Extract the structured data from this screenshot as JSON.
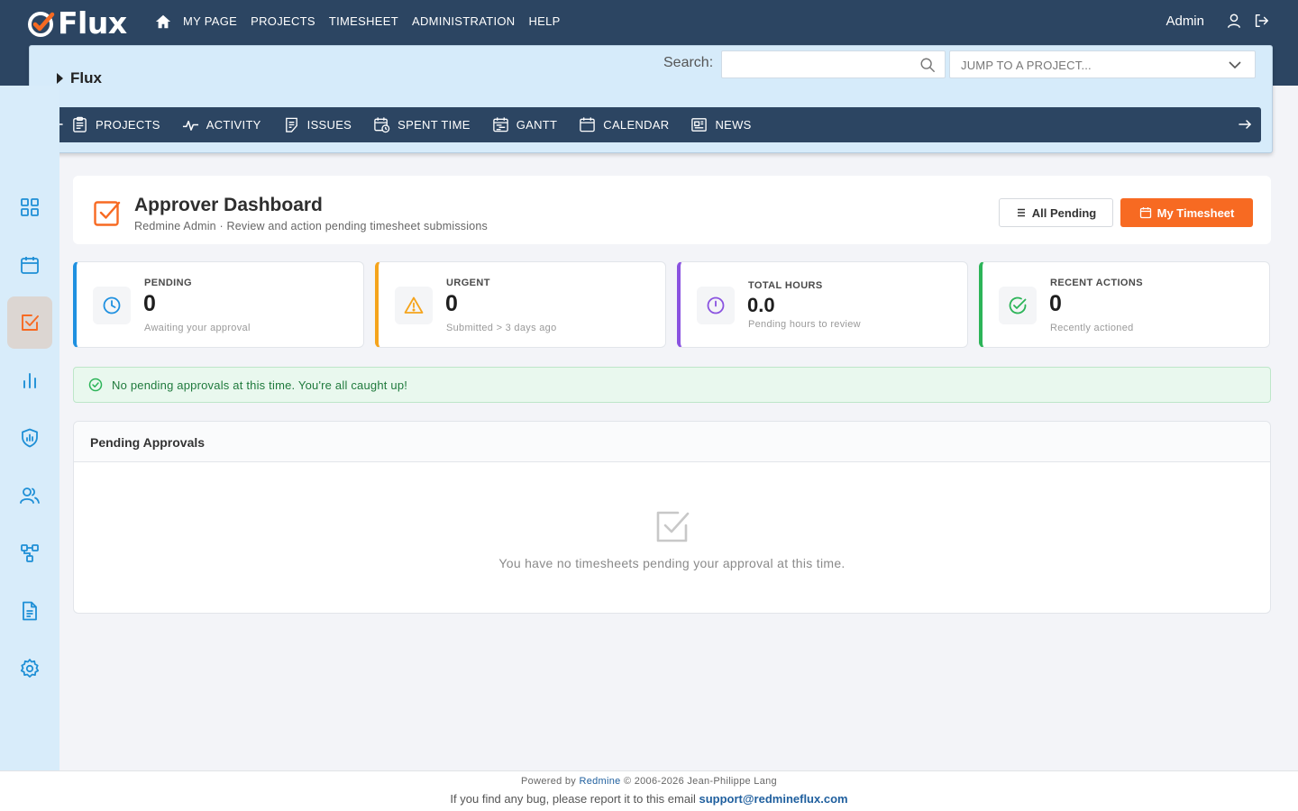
{
  "app": {
    "logo_text": "Flux"
  },
  "topnav": {
    "items": [
      "MY PAGE",
      "PROJECTS",
      "TIMESHEET",
      "ADMINISTRATION",
      "HELP"
    ],
    "user": "Admin"
  },
  "project": {
    "name": "Flux",
    "search_label": "Search:",
    "search_value": "",
    "jump_placeholder": "JUMP TO A PROJECT..."
  },
  "project_menu": {
    "items": [
      {
        "label": "PROJECTS",
        "icon": "clipboard-icon"
      },
      {
        "label": "ACTIVITY",
        "icon": "activity-icon"
      },
      {
        "label": "ISSUES",
        "icon": "issues-icon"
      },
      {
        "label": "SPENT TIME",
        "icon": "calendar-clock-icon"
      },
      {
        "label": "GANTT",
        "icon": "gantt-icon"
      },
      {
        "label": "CALENDAR",
        "icon": "calendar-icon"
      },
      {
        "label": "NEWS",
        "icon": "news-icon"
      }
    ]
  },
  "sidebar": {
    "items": [
      {
        "icon": "grid-icon",
        "active": false
      },
      {
        "icon": "calendar-icon",
        "active": false
      },
      {
        "icon": "checkbox-icon",
        "active": true
      },
      {
        "icon": "bar-chart-icon",
        "active": false
      },
      {
        "icon": "shield-chart-icon",
        "active": false
      },
      {
        "icon": "users-icon",
        "active": false
      },
      {
        "icon": "workflow-icon",
        "active": false
      },
      {
        "icon": "document-icon",
        "active": false
      },
      {
        "icon": "settings-icon",
        "active": false
      }
    ]
  },
  "dashboard": {
    "title": "Approver Dashboard",
    "subtitle": "Redmine Admin · Review and action pending timesheet submissions",
    "btn_all_pending": "All Pending",
    "btn_my_timesheet": "My Timesheet"
  },
  "stats": [
    {
      "label": "PENDING",
      "value": "0",
      "desc": "Awaiting your approval",
      "color": "#1e90e0",
      "icon": "clock-icon"
    },
    {
      "label": "URGENT",
      "value": "0",
      "desc": "Submitted > 3 days ago",
      "color": "#f5a41c",
      "icon": "warning-icon"
    },
    {
      "label": "TOTAL HOURS",
      "value": "0.0",
      "desc": "Pending hours to review",
      "color": "#8a52e0",
      "icon": "timer-icon"
    },
    {
      "label": "RECENT ACTIONS",
      "value": "0",
      "desc": "Recently actioned",
      "color": "#2cb458",
      "icon": "check-circle-icon"
    }
  ],
  "alert": {
    "text": "No pending approvals at this time. You're all caught up!"
  },
  "pending_table": {
    "title": "Pending Approvals",
    "empty_text": "You have no timesheets pending your approval at this time."
  },
  "footer": {
    "powered_prefix": "Powered by",
    "powered_link": "Redmine",
    "copyright": "© 2006-2026 Jean-Philippe Lang",
    "bug_text": "If you find any bug, please report it to this email",
    "email": "support@redmineflux.com"
  }
}
